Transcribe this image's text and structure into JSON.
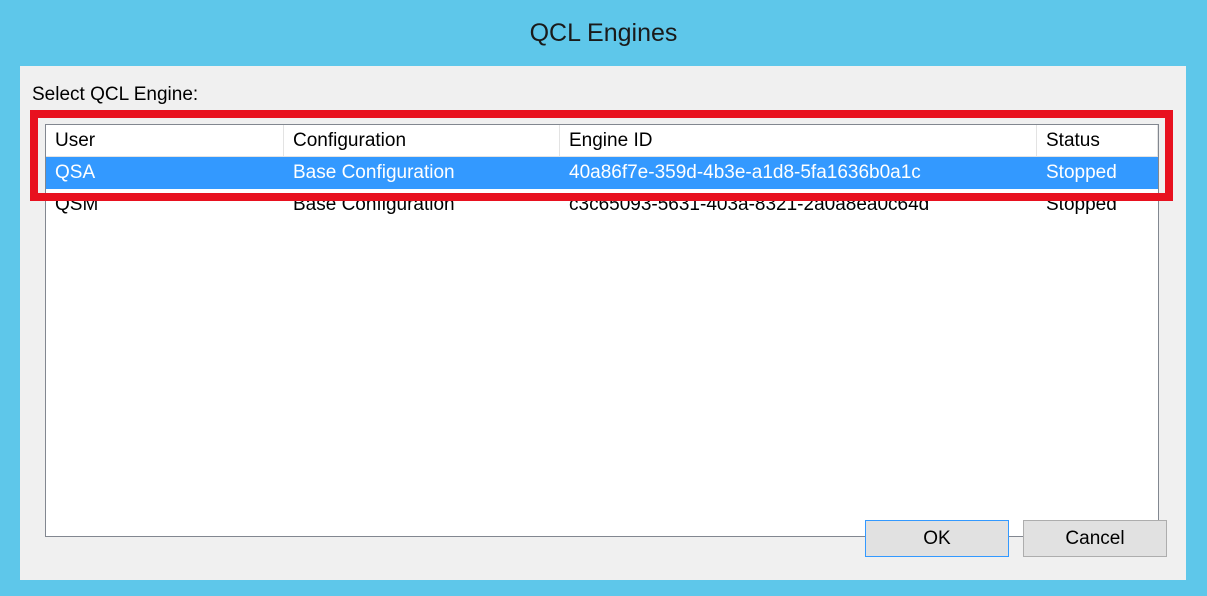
{
  "window": {
    "title": "QCL Engines"
  },
  "dialog": {
    "select_label": "Select QCL Engine:"
  },
  "table": {
    "columns": [
      "User",
      "Configuration",
      "Engine ID",
      "Status"
    ],
    "rows": [
      {
        "user": "QSA",
        "configuration": "Base Configuration",
        "engine_id": "40a86f7e-359d-4b3e-a1d8-5fa1636b0a1c",
        "status": "Stopped",
        "selected": true
      },
      {
        "user": "QSM",
        "configuration": "Base Configuration",
        "engine_id": "c3c65093-5631-403a-8321-2a0a8ea0c64d",
        "status": "Stopped",
        "selected": false
      }
    ]
  },
  "buttons": {
    "ok_label": "OK",
    "cancel_label": "Cancel"
  },
  "colors": {
    "window_frame": "#5ec7ea",
    "selection": "#3399ff",
    "highlight_annotation": "#e8111f"
  }
}
